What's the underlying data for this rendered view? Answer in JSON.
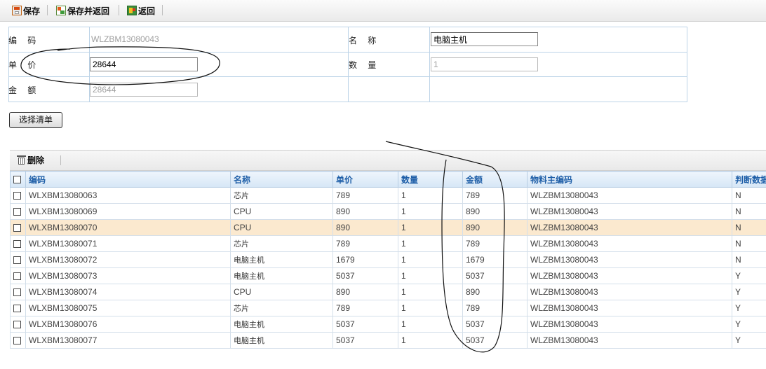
{
  "toolbar": {
    "save_label": "保存",
    "save_return_label": "保存并返回",
    "back_label": "返回"
  },
  "form": {
    "code_label": "编    码",
    "code_value": "WLZBM13080043",
    "name_label": "名    称",
    "name_value": "电脑主机",
    "price_label": "单    价",
    "price_value": "28644",
    "qty_label": "数    量",
    "qty_value": "1",
    "amount_label": "金    额",
    "amount_value": "28644"
  },
  "select_button_label": "选择清单",
  "grid": {
    "delete_label": "删除",
    "headers": [
      "编码",
      "名称",
      "单价",
      "数量",
      "金额",
      "物料主编码",
      "判断数据"
    ],
    "rows": [
      {
        "code": "WLXBM13080063",
        "name": "芯片",
        "price": "789",
        "qty": "1",
        "amount": "789",
        "master": "WLZBM13080043",
        "flag": "N"
      },
      {
        "code": "WLXBM13080069",
        "name": "CPU",
        "price": "890",
        "qty": "1",
        "amount": "890",
        "master": "WLZBM13080043",
        "flag": "N"
      },
      {
        "code": "WLXBM13080070",
        "name": "CPU",
        "price": "890",
        "qty": "1",
        "amount": "890",
        "master": "WLZBM13080043",
        "flag": "N"
      },
      {
        "code": "WLXBM13080071",
        "name": "芯片",
        "price": "789",
        "qty": "1",
        "amount": "789",
        "master": "WLZBM13080043",
        "flag": "N"
      },
      {
        "code": "WLXBM13080072",
        "name": "电脑主机",
        "price": "1679",
        "qty": "1",
        "amount": "1679",
        "master": "WLZBM13080043",
        "flag": "N"
      },
      {
        "code": "WLXBM13080073",
        "name": "电脑主机",
        "price": "5037",
        "qty": "1",
        "amount": "5037",
        "master": "WLZBM13080043",
        "flag": "Y"
      },
      {
        "code": "WLXBM13080074",
        "name": "CPU",
        "price": "890",
        "qty": "1",
        "amount": "890",
        "master": "WLZBM13080043",
        "flag": "Y"
      },
      {
        "code": "WLXBM13080075",
        "name": "芯片",
        "price": "789",
        "qty": "1",
        "amount": "789",
        "master": "WLZBM13080043",
        "flag": "Y"
      },
      {
        "code": "WLXBM13080076",
        "name": "电脑主机",
        "price": "5037",
        "qty": "1",
        "amount": "5037",
        "master": "WLZBM13080043",
        "flag": "Y"
      },
      {
        "code": "WLXBM13080077",
        "name": "电脑主机",
        "price": "5037",
        "qty": "1",
        "amount": "5037",
        "master": "WLZBM13080043",
        "flag": "Y"
      }
    ]
  },
  "colors": {
    "header_text": "#1f5fa8",
    "selected_row": "#fbe9cf",
    "border": "#bcd3e7"
  }
}
